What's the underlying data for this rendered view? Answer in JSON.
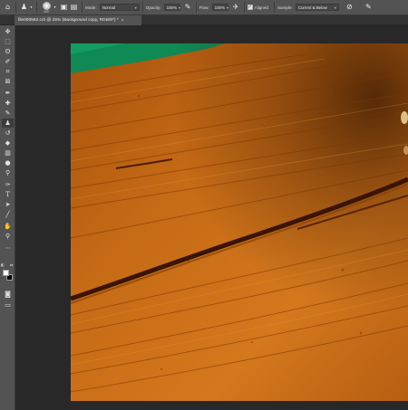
{
  "window": {
    "document_tab_title": "file000562.cr2 @ 25% (Background copy, RGB/8*) *",
    "document_tab_close": "×"
  },
  "options_bar": {
    "tool_preset_icon": "clone-stamp-icon",
    "brush_size": "200",
    "mode_label": "Mode:",
    "mode_value": "Normal",
    "opacity_label": "Opacity:",
    "opacity_value": "100%",
    "flow_label": "Flow:",
    "flow_value": "100%",
    "aligned_label": "Aligned",
    "aligned_checked": true,
    "sample_label": "Sample:",
    "sample_value": "Current & Below"
  },
  "toolbar": {
    "tools": [
      "move-icon",
      "marquee-icon",
      "lasso-icon",
      "quick-select-icon",
      "crop-icon",
      "frame-icon",
      "eyedropper-icon",
      "healing-brush-icon",
      "brush-icon",
      "clone-stamp-icon",
      "history-brush-icon",
      "eraser-icon",
      "gradient-icon",
      "blur-icon",
      "dodge-icon",
      "pen-icon",
      "type-icon",
      "path-select-icon",
      "line-icon",
      "hand-icon",
      "zoom-icon",
      "more-tools-icon"
    ],
    "active_tool": "clone-stamp-icon",
    "foreground_color": "#ffffff",
    "background_color": "#000000"
  },
  "canvas": {
    "background": "#282828",
    "image_colors": {
      "wood_light": "#d47a1c",
      "wood_mid": "#b35c10",
      "wood_dark": "#6e2f05",
      "green_backdrop": "#0f8a55"
    }
  }
}
